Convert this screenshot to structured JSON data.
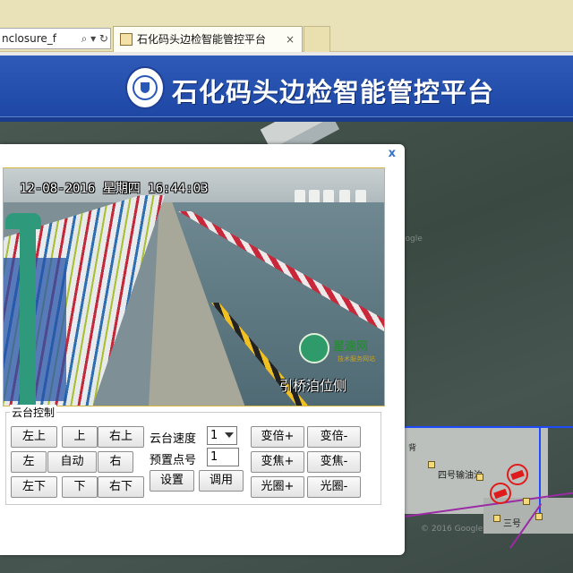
{
  "browser": {
    "address_text": "nclosure_f",
    "address_icons": "⌕ ▾ ↻",
    "tab_title": "石化码头边检智能管控平台",
    "tab_close": "×"
  },
  "header": {
    "title": "石化码头边检智能管控平台"
  },
  "map": {
    "berth4_label": "四号输油泊",
    "berth3_label": "三号",
    "top_label": "背",
    "watermark": "© 2016 Google",
    "watermark2": "Google"
  },
  "popup": {
    "close_label": "x",
    "video": {
      "timestamp": "12-08-2016 星期四 16:44:03",
      "caption": "引桥泊位侧",
      "watermark_name": "星速网",
      "watermark_sub": "技术服务网站"
    },
    "ptz": {
      "legend": "云台控制",
      "direction": {
        "up_left": "左上",
        "up": "上",
        "up_right": "右上",
        "left": "左",
        "auto": "自动",
        "right": "右",
        "down_left": "左下",
        "down": "下",
        "down_right": "右下"
      },
      "speed_label": "云台速度",
      "speed_value": "1",
      "preset_label": "预置点号",
      "preset_value": "1",
      "set_label": "设置",
      "call_label": "调用",
      "zoom_in": "变倍+",
      "zoom_out": "变倍-",
      "focus_in": "变焦+",
      "focus_out": "变焦-",
      "iris_open": "光圈+",
      "iris_close": "光圈-"
    }
  }
}
